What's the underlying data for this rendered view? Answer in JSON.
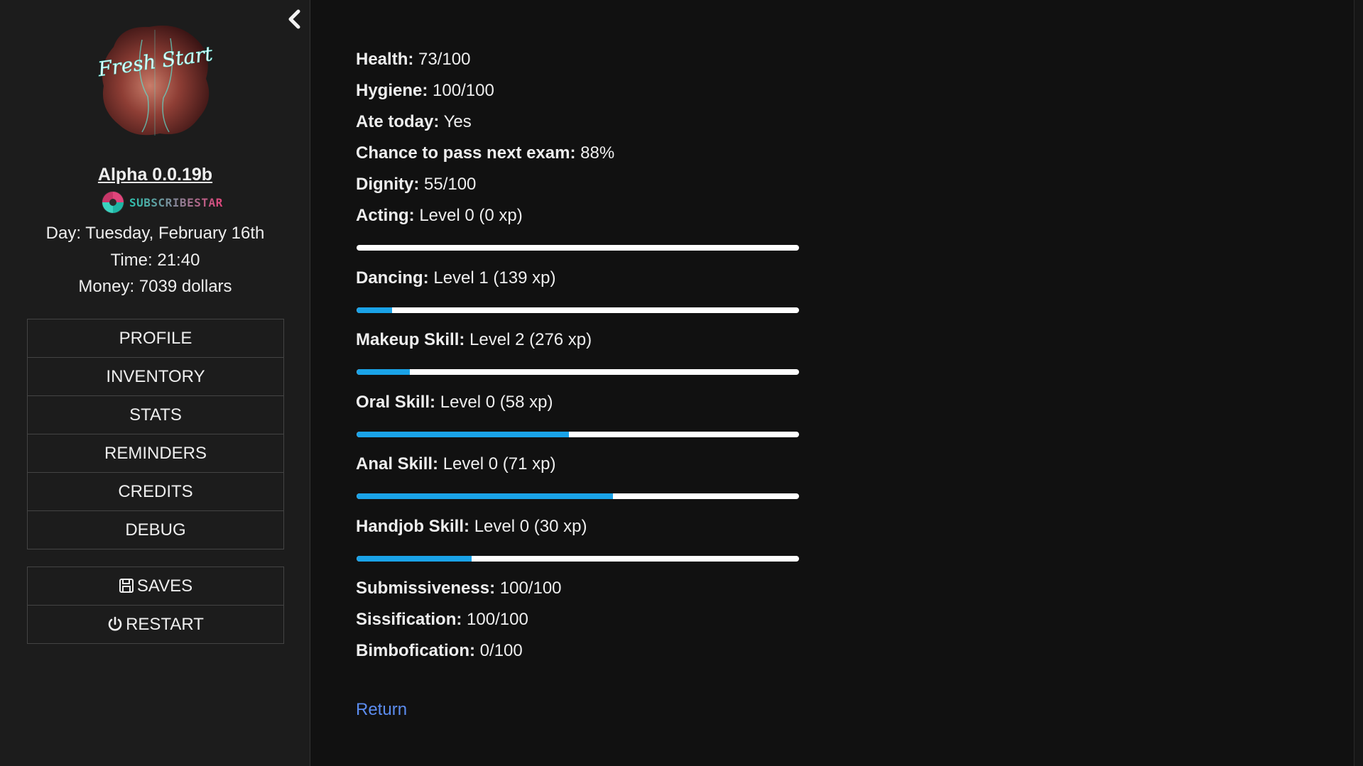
{
  "sidebar": {
    "version": "Alpha 0.0.19b",
    "subscribestar_label": "SUBSCRIBESTAR",
    "day": "Day: Tuesday, February 16th",
    "time": "Time: 21:40",
    "money": "Money: 7039 dollars",
    "logo_text": "Fresh Start",
    "menu": [
      "PROFILE",
      "INVENTORY",
      "STATS",
      "REMINDERS",
      "CREDITS",
      "DEBUG"
    ],
    "saves_label": "SAVES",
    "restart_label": "RESTART"
  },
  "stats": {
    "health_label": "Health:",
    "health_value": "73/100",
    "hygiene_label": "Hygiene:",
    "hygiene_value": "100/100",
    "ate_label": "Ate today:",
    "ate_value": "Yes",
    "exam_label": "Chance to pass next exam:",
    "exam_value": "88%",
    "dignity_label": "Dignity:",
    "dignity_value": "55/100",
    "submissiveness_label": "Submissiveness:",
    "submissiveness_value": "100/100",
    "sissification_label": "Sissification:",
    "sissification_value": "100/100",
    "bimbofication_label": "Bimbofication:",
    "bimbofication_value": "0/100"
  },
  "skills": [
    {
      "label": "Acting:",
      "value": "Level 0 (0 xp)",
      "progress": 0.0
    },
    {
      "label": "Dancing:",
      "value": "Level 1 (139 xp)",
      "progress": 0.08
    },
    {
      "label": "Makeup Skill:",
      "value": "Level 2 (276 xp)",
      "progress": 0.12
    },
    {
      "label": "Oral Skill:",
      "value": "Level 0 (58 xp)",
      "progress": 0.48
    },
    {
      "label": "Anal Skill:",
      "value": "Level 0 (71 xp)",
      "progress": 0.58
    },
    {
      "label": "Handjob Skill:",
      "value": "Level 0 (30 xp)",
      "progress": 0.26
    }
  ],
  "return_label": "Return",
  "colors": {
    "accent": "#1aa3e8",
    "link": "#5c8df0",
    "sidebar_bg": "#1c1c1c",
    "main_bg": "#111111"
  }
}
